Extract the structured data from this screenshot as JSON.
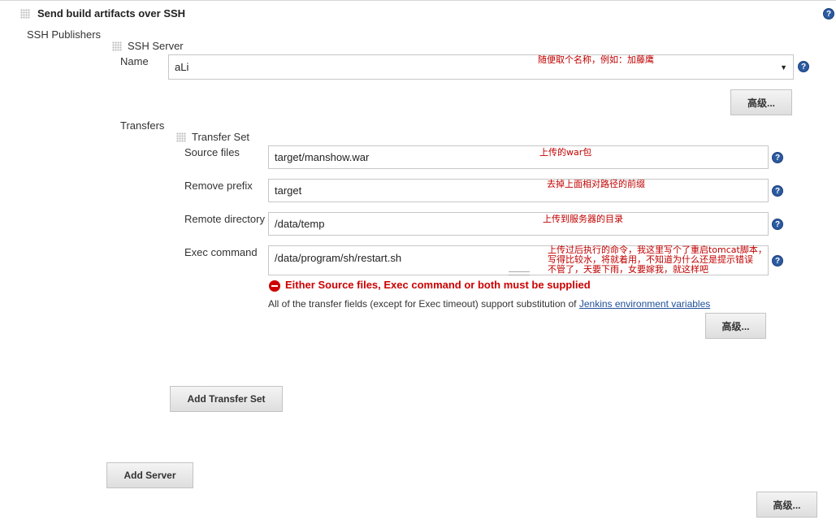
{
  "section": {
    "title": "Send build artifacts over SSH"
  },
  "publishers": {
    "label": "SSH Publishers",
    "server_block_title": "SSH Server",
    "name_label": "Name",
    "name_value": "aLi",
    "name_note": "随便取个名称，例如：加藤鹰",
    "advanced_label": "高级..."
  },
  "transfers": {
    "label": "Transfers",
    "set_title": "Transfer Set",
    "source_label": "Source files",
    "source_value": "target/manshow.war",
    "source_note": "上传的war包",
    "prefix_label": "Remove prefix",
    "prefix_value": "target",
    "prefix_note": "去掉上面相对路径的前缀",
    "remote_label": "Remote directory",
    "remote_value": "/data/temp",
    "remote_note": "上传到服务器的目录",
    "exec_label": "Exec command",
    "exec_value": "/data/program/sh/restart.sh",
    "exec_note_1": "上传过后执行的命令，我这里写个了重启tomcat脚本，",
    "exec_note_2": "写得比较水，将就着用，不知道为什么还是提示错误",
    "exec_note_3": "不管了，天要下雨，女要嫁我，就这样吧",
    "error": "Either Source files, Exec command or both must be supplied",
    "hint_prefix": "All of the transfer fields (except for Exec timeout) support substitution of ",
    "hint_link": "Jenkins environment variables",
    "advanced_label": "高级..."
  },
  "buttons": {
    "add_transfer_set": "Add Transfer Set",
    "add_server": "Add Server",
    "advanced": "高级..."
  },
  "icons": {
    "help": "?"
  }
}
